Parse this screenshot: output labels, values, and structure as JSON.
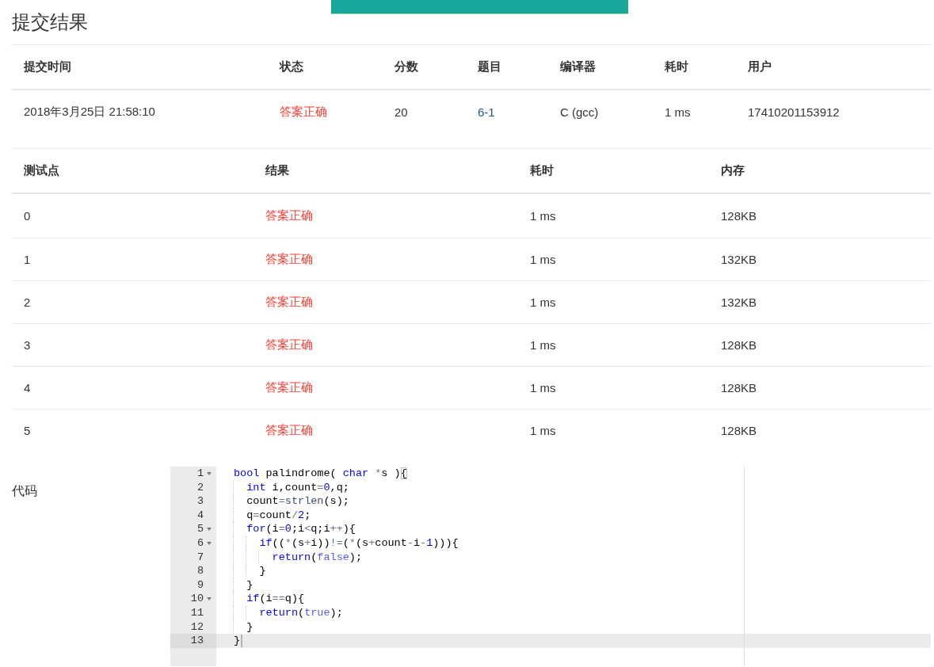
{
  "notification": {
    "kind": "success"
  },
  "title": "提交结果",
  "submission_table": {
    "columns": [
      "提交时间",
      "状态",
      "分数",
      "题目",
      "编译器",
      "耗时",
      "用户"
    ],
    "rows": [
      {
        "cells": [
          {
            "kind": "text",
            "text": "2018年3月25日 21:58:10"
          },
          {
            "kind": "status",
            "text": "答案正确"
          },
          {
            "kind": "text",
            "text": "20"
          },
          {
            "kind": "link",
            "text": "6-1"
          },
          {
            "kind": "text",
            "text": "C (gcc)"
          },
          {
            "kind": "text",
            "text": "1 ms"
          },
          {
            "kind": "text",
            "text": "17410201153912"
          }
        ]
      }
    ]
  },
  "testcase_table": {
    "columns": [
      "测试点",
      "结果",
      "耗时",
      "内存"
    ],
    "rows": [
      {
        "cells": [
          {
            "kind": "text",
            "text": "0"
          },
          {
            "kind": "status",
            "text": "答案正确"
          },
          {
            "kind": "text",
            "text": "1 ms"
          },
          {
            "kind": "text",
            "text": "128KB"
          }
        ]
      },
      {
        "cells": [
          {
            "kind": "text",
            "text": "1"
          },
          {
            "kind": "status",
            "text": "答案正确"
          },
          {
            "kind": "text",
            "text": "1 ms"
          },
          {
            "kind": "text",
            "text": "132KB"
          }
        ]
      },
      {
        "cells": [
          {
            "kind": "text",
            "text": "2"
          },
          {
            "kind": "status",
            "text": "答案正确"
          },
          {
            "kind": "text",
            "text": "1 ms"
          },
          {
            "kind": "text",
            "text": "132KB"
          }
        ]
      },
      {
        "cells": [
          {
            "kind": "text",
            "text": "3"
          },
          {
            "kind": "status",
            "text": "答案正确"
          },
          {
            "kind": "text",
            "text": "1 ms"
          },
          {
            "kind": "text",
            "text": "128KB"
          }
        ]
      },
      {
        "cells": [
          {
            "kind": "text",
            "text": "4"
          },
          {
            "kind": "status",
            "text": "答案正确"
          },
          {
            "kind": "text",
            "text": "1 ms"
          },
          {
            "kind": "text",
            "text": "128KB"
          }
        ]
      },
      {
        "cells": [
          {
            "kind": "text",
            "text": "5"
          },
          {
            "kind": "status",
            "text": "答案正确"
          },
          {
            "kind": "text",
            "text": "1 ms"
          },
          {
            "kind": "text",
            "text": "128KB"
          }
        ]
      }
    ]
  },
  "code_label": "代码",
  "editor": {
    "lines": [
      {
        "number": "1",
        "foldable": true,
        "active": false,
        "tokens": [
          {
            "kind": "keyword",
            "text": "bool"
          },
          {
            "kind": "text",
            "text": " palindrome( "
          },
          {
            "kind": "keyword",
            "text": "char"
          },
          {
            "kind": "operator",
            "text": " *"
          },
          {
            "kind": "text",
            "text": "s )"
          },
          {
            "kind": "paren",
            "text": "{",
            "matched": true
          }
        ]
      },
      {
        "number": "2",
        "foldable": false,
        "active": false,
        "tokens": [
          {
            "kind": "keyword",
            "text": "  int"
          },
          {
            "kind": "text",
            "text": " i,count"
          },
          {
            "kind": "operator",
            "text": "="
          },
          {
            "kind": "number",
            "text": "0"
          },
          {
            "kind": "text",
            "text": ",q;"
          }
        ]
      },
      {
        "number": "3",
        "foldable": false,
        "active": false,
        "tokens": [
          {
            "kind": "text",
            "text": "  count"
          },
          {
            "kind": "operator",
            "text": "="
          },
          {
            "kind": "function",
            "text": "strlen"
          },
          {
            "kind": "text",
            "text": "(s);"
          }
        ]
      },
      {
        "number": "4",
        "foldable": false,
        "active": false,
        "tokens": [
          {
            "kind": "text",
            "text": "  q"
          },
          {
            "kind": "operator",
            "text": "="
          },
          {
            "kind": "text",
            "text": "count"
          },
          {
            "kind": "operator",
            "text": "/"
          },
          {
            "kind": "number",
            "text": "2"
          },
          {
            "kind": "text",
            "text": ";"
          }
        ]
      },
      {
        "number": "5",
        "foldable": true,
        "active": false,
        "tokens": [
          {
            "kind": "keyword",
            "text": "  for"
          },
          {
            "kind": "text",
            "text": "(i"
          },
          {
            "kind": "operator",
            "text": "="
          },
          {
            "kind": "number",
            "text": "0"
          },
          {
            "kind": "text",
            "text": ";i"
          },
          {
            "kind": "operator",
            "text": "<"
          },
          {
            "kind": "text",
            "text": "q;i"
          },
          {
            "kind": "operator",
            "text": "++"
          },
          {
            "kind": "text",
            "text": "){"
          }
        ]
      },
      {
        "number": "6",
        "foldable": true,
        "active": false,
        "tokens": [
          {
            "kind": "keyword",
            "text": "    if"
          },
          {
            "kind": "text",
            "text": "(("
          },
          {
            "kind": "operator",
            "text": "*"
          },
          {
            "kind": "text",
            "text": "(s"
          },
          {
            "kind": "operator",
            "text": "+"
          },
          {
            "kind": "text",
            "text": "i))"
          },
          {
            "kind": "operator",
            "text": "!="
          },
          {
            "kind": "text",
            "text": "("
          },
          {
            "kind": "operator",
            "text": "*"
          },
          {
            "kind": "text",
            "text": "(s"
          },
          {
            "kind": "operator",
            "text": "+"
          },
          {
            "kind": "text",
            "text": "count"
          },
          {
            "kind": "operator",
            "text": "-"
          },
          {
            "kind": "text",
            "text": "i"
          },
          {
            "kind": "operator",
            "text": "-"
          },
          {
            "kind": "number",
            "text": "1"
          },
          {
            "kind": "text",
            "text": "))){"
          }
        ]
      },
      {
        "number": "7",
        "foldable": false,
        "active": false,
        "tokens": [
          {
            "kind": "keyword",
            "text": "      return"
          },
          {
            "kind": "text",
            "text": "("
          },
          {
            "kind": "constant",
            "text": "false"
          },
          {
            "kind": "text",
            "text": ");"
          }
        ]
      },
      {
        "number": "8",
        "foldable": false,
        "active": false,
        "tokens": [
          {
            "kind": "text",
            "text": "    }"
          }
        ]
      },
      {
        "number": "9",
        "foldable": false,
        "active": false,
        "tokens": [
          {
            "kind": "text",
            "text": "  }"
          }
        ]
      },
      {
        "number": "10",
        "foldable": true,
        "active": false,
        "tokens": [
          {
            "kind": "keyword",
            "text": "  if"
          },
          {
            "kind": "text",
            "text": "(i"
          },
          {
            "kind": "operator",
            "text": "=="
          },
          {
            "kind": "text",
            "text": "q){"
          }
        ]
      },
      {
        "number": "11",
        "foldable": false,
        "active": false,
        "tokens": [
          {
            "kind": "keyword",
            "text": "    return"
          },
          {
            "kind": "text",
            "text": "("
          },
          {
            "kind": "constant",
            "text": "true"
          },
          {
            "kind": "text",
            "text": ");"
          }
        ]
      },
      {
        "number": "12",
        "foldable": false,
        "active": false,
        "tokens": [
          {
            "kind": "text",
            "text": "  }"
          }
        ]
      },
      {
        "number": "13",
        "foldable": false,
        "active": true,
        "tokens": [
          {
            "kind": "text",
            "text": "}"
          }
        ]
      }
    ]
  }
}
